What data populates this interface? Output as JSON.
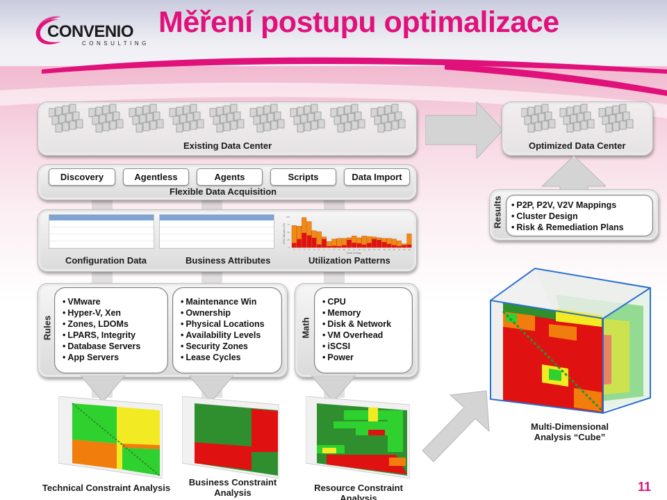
{
  "header": {
    "title": "Měření postupu optimalizace",
    "logo": {
      "name": "CONVENIO",
      "tagline": "CONSULTING",
      "brand_color": "#e0117a"
    }
  },
  "existing_dc": {
    "label": "Existing Data Center"
  },
  "optimized_dc": {
    "label": "Optimized Data Center"
  },
  "acquisition": {
    "label": "Flexible Data Acquisition",
    "methods": [
      "Discovery",
      "Agentless",
      "Agents",
      "Scripts",
      "Data Import"
    ]
  },
  "data_sources": {
    "items": [
      "Configuration Data",
      "Business Attributes",
      "Utilization Patterns"
    ]
  },
  "utilization_chart": {
    "ylabel": "CPU Utilization (%)",
    "xlabel": "Time of Day",
    "ylim": [
      0,
      100
    ],
    "yticks": [
      "0",
      "25",
      "50",
      "75",
      "100"
    ],
    "hours": [
      "0",
      "1",
      "2",
      "3",
      "4",
      "5",
      "6",
      "7",
      "8",
      "9",
      "10",
      "11",
      "12",
      "13",
      "14",
      "15",
      "16",
      "17",
      "18",
      "19",
      "20",
      "21",
      "22",
      "23"
    ],
    "peak": [
      72,
      70,
      98,
      85,
      55,
      52,
      35,
      20,
      28,
      30,
      30,
      32,
      38,
      32,
      38,
      36,
      35,
      32,
      30,
      30,
      28,
      22,
      12,
      45
    ],
    "average": [
      15,
      28,
      48,
      40,
      32,
      10,
      28,
      5,
      6,
      5,
      8,
      25,
      16,
      14,
      10,
      15,
      28,
      25,
      18,
      12,
      8,
      5,
      8,
      10
    ]
  },
  "results": {
    "label": "Results",
    "items": [
      "P2P, P2V, V2V Mappings",
      "Cluster Design",
      "Risk & Remediation Plans"
    ]
  },
  "rules": {
    "label": "Rules",
    "technical": [
      "VMware",
      "Hyper-V, Xen",
      "Zones, LDOMs",
      "LPARS, Integrity",
      "Database Servers",
      "App Servers"
    ],
    "business": [
      "Maintenance Win",
      "Ownership",
      "Physical Locations",
      "Availability Levels",
      "Security Zones",
      "Lease Cycles"
    ]
  },
  "math": {
    "label": "Math",
    "items": [
      "CPU",
      "Memory",
      "Disk & Network",
      "VM Overhead",
      "iSCSI",
      "Power"
    ]
  },
  "analyses": [
    {
      "label": "Technical Constraint Analysis"
    },
    {
      "label": "Business Constraint Analysis"
    },
    {
      "label": "Resource Constraint Analysis"
    }
  ],
  "cube": {
    "label": "Multi-Dimensional Analysis “Cube”"
  },
  "colors": {
    "green": "#2ed12e",
    "dark_green": "#2f8f2f",
    "yellow": "#f2ea22",
    "orange": "#f07d0c",
    "red": "#e01111",
    "cube_edge": "#2a6fd1"
  },
  "page_number": "11"
}
